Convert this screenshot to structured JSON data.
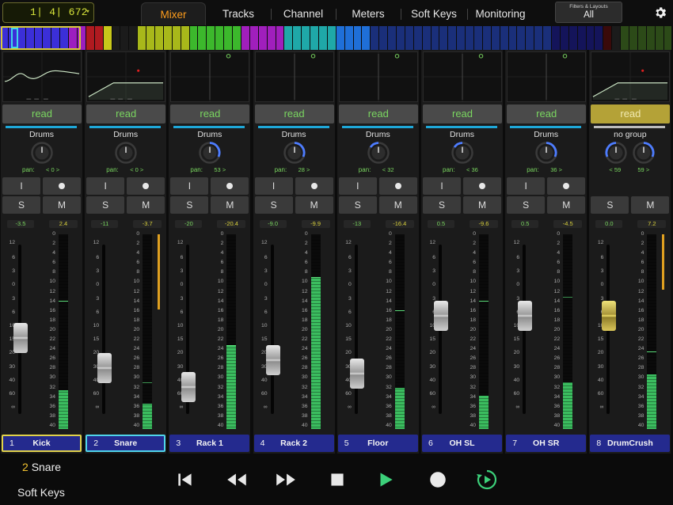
{
  "position": {
    "value": "1|  4|  672",
    "caret": "▾"
  },
  "tabs": [
    {
      "label": "Mixer",
      "active": true,
      "w": 82
    },
    {
      "label": "Tracks",
      "active": false,
      "w": 82
    },
    {
      "label": "Channel",
      "active": false,
      "w": 82
    },
    {
      "label": "Meters",
      "active": false,
      "w": 82
    },
    {
      "label": "Soft Keys",
      "active": false,
      "w": 82
    },
    {
      "label": "Monitoring",
      "active": false,
      "w": 82
    }
  ],
  "filters": {
    "title": "Filters & Layouts",
    "value": "All"
  },
  "overview": [
    "#3b2fd8",
    "#3b2fd8",
    "#3b2fd8",
    "#3b2fd8",
    "#3b2fd8",
    "#3b2fd8",
    "#3b2fd8",
    "#3b2fd8",
    "#9c1fc0",
    "#9c1fc0",
    "#b01a20",
    "#b01a20",
    "#c8c81a",
    "#1b1b1b",
    "#1b1b1b",
    "#1b1b1b",
    "#a8b81a",
    "#a8b81a",
    "#a8b81a",
    "#a8b81a",
    "#a8b81a",
    "#a8b81a",
    "#3cb82c",
    "#3cb82c",
    "#3cb82c",
    "#3cb82c",
    "#3cb82c",
    "#3cb82c",
    "#a01fbc",
    "#a01fbc",
    "#a01fbc",
    "#a01fbc",
    "#a01fbc",
    "#1fa8a8",
    "#1fa8a8",
    "#1fa8a8",
    "#1fa8a8",
    "#1fa8a8",
    "#1fa8a8",
    "#1f6fd8",
    "#1f6fd8",
    "#1f6fd8",
    "#1f6fd8",
    "#1a2f7a",
    "#1a2f7a",
    "#1a2f7a",
    "#1a2f7a",
    "#1a2f7a",
    "#1a2f7a",
    "#1a2f7a",
    "#1a2f7a",
    "#1a2f7a",
    "#1a2f7a",
    "#1a2f7a",
    "#1a2f7a",
    "#1a2f7a",
    "#1a2f7a",
    "#1a2f7a",
    "#1a2f7a",
    "#1a2f7a",
    "#1a2f7a",
    "#1a2f7a",
    "#1a2f7a",
    "#1a2f7a",
    "#14145a",
    "#14145a",
    "#14145a",
    "#14145a",
    "#14145a",
    "#14145a",
    "#3a0a0a",
    "#1b1b1b",
    "#2c4a18",
    "#2c4a18",
    "#2c4a18",
    "#2c4a18",
    "#2c4a18",
    "#2c4a18"
  ],
  "scale_left": [
    "12",
    "6",
    "3",
    "0",
    "3",
    "6",
    "10",
    "15",
    "20",
    "30",
    "40",
    "60",
    "∞"
  ],
  "scale_right": [
    "0",
    "2",
    "4",
    "6",
    "8",
    "10",
    "12",
    "14",
    "16",
    "18",
    "20",
    "22",
    "24",
    "26",
    "28",
    "30",
    "32",
    "34",
    "36",
    "38",
    "40"
  ],
  "labels": {
    "read": "read",
    "pan": "pan:",
    "input": "I",
    "solo": "S",
    "mute": "M"
  },
  "strips": [
    {
      "num": "1",
      "name": "Kick",
      "group": "Drums",
      "pan": "< 0 >",
      "pan_l": "",
      "auto": "read",
      "gain": "-3.5",
      "peak": "2.4",
      "fader": 0.45,
      "meter": 0.2,
      "peakpos": 0.66,
      "eq": "curve",
      "sel": "y",
      "gold": false,
      "rec": true
    },
    {
      "num": "2",
      "name": "Snare",
      "group": "Drums",
      "pan": "< 0 >",
      "pan_l": "",
      "auto": "read",
      "gain": "-11",
      "peak": "-3.7",
      "fader": 0.27,
      "meter": 0.13,
      "peakpos": 0.24,
      "eq": "shelf",
      "sel": "c",
      "gold": false,
      "rec": true,
      "orangebar": true
    },
    {
      "num": "3",
      "name": "Rack 1",
      "group": "Drums",
      "pan": "53 >",
      "pan_l": "",
      "auto": "read",
      "gain": "-20",
      "peak": "-20.4",
      "fader": 0.16,
      "meter": 0.43,
      "peakpos": 0.43,
      "eq": "flat",
      "sel": "",
      "gold": false,
      "rec": true
    },
    {
      "num": "4",
      "name": "Rack 2",
      "group": "Drums",
      "pan": "28 >",
      "pan_l": "",
      "auto": "read",
      "gain": "-9.0",
      "peak": "-9.9",
      "fader": 0.32,
      "meter": 0.78,
      "peakpos": 0.78,
      "eq": "flat",
      "sel": "",
      "gold": false,
      "rec": true
    },
    {
      "num": "5",
      "name": "Floor",
      "group": "Drums",
      "pan": "< 32",
      "pan_l": "",
      "auto": "read",
      "gain": "-13",
      "peak": "-16.4",
      "fader": 0.24,
      "meter": 0.21,
      "peakpos": 0.61,
      "eq": "flat",
      "sel": "",
      "gold": false,
      "rec": true
    },
    {
      "num": "6",
      "name": "OH SL",
      "group": "Drums",
      "pan": "< 36",
      "pan_l": "",
      "auto": "read",
      "gain": "0.5",
      "peak": "-9.6",
      "fader": 0.58,
      "meter": 0.17,
      "peakpos": 0.66,
      "eq": "flat",
      "sel": "",
      "gold": false,
      "rec": true
    },
    {
      "num": "7",
      "name": "OH SR",
      "group": "Drums",
      "pan": "36 >",
      "pan_l": "",
      "auto": "read",
      "gain": "0.5",
      "peak": "-4.5",
      "fader": 0.58,
      "meter": 0.24,
      "peakpos": 0.68,
      "eq": "flat",
      "sel": "",
      "gold": false,
      "rec": true
    },
    {
      "num": "8",
      "name": "DrumCrush",
      "group": "no group",
      "pan": "59 >",
      "pan_l": "< 59",
      "auto": "read",
      "gain": "0.0",
      "peak": "7.2",
      "fader": 0.58,
      "meter": 0.28,
      "peakpos": 0.4,
      "eq": "shelf",
      "sel": "",
      "gold": true,
      "rec": false,
      "orangebar": true
    }
  ],
  "bottom": {
    "sel_num": "2",
    "sel_name": "Snare",
    "softkeys": "Soft Keys"
  },
  "transport": [
    "to-start",
    "rewind",
    "fast-forward",
    "stop",
    "play",
    "record",
    "cycle"
  ]
}
